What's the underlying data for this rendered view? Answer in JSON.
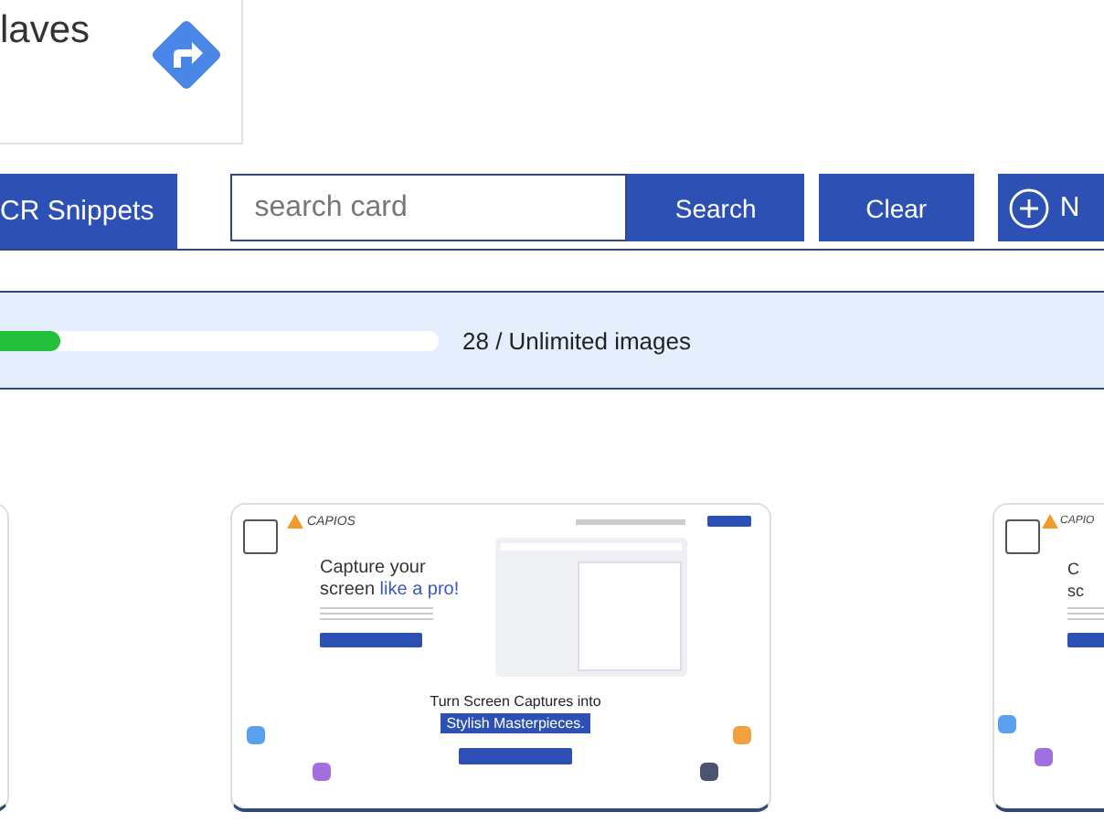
{
  "top_card": {
    "title": "laves"
  },
  "tabs": [
    {
      "label": "CR Snippets",
      "selected": true
    }
  ],
  "search": {
    "placeholder": "search card"
  },
  "buttons": [
    {
      "label": "Search",
      "kind": "text"
    },
    {
      "label": "Clear",
      "kind": "text"
    },
    {
      "label": "N",
      "kind": "add"
    }
  ],
  "quota": {
    "level": 0.17,
    "text": "28 / Unlimited images"
  },
  "cards": [
    {
      "kind": "edge"
    },
    {
      "kind": "full",
      "checked": false,
      "preview": {
        "logo": "CAPIOS",
        "headline": "Capture your",
        "headline_line2": "screen",
        "headline_accent": "like a pro!",
        "banner": "Turn Screen Captures into",
        "banner_accent": "Stylish Masterpieces."
      }
    },
    {
      "kind": "cut",
      "checked": false,
      "preview": {
        "logo": "CAPIO",
        "headline": "C",
        "headline_line2": "sc"
      }
    }
  ]
}
